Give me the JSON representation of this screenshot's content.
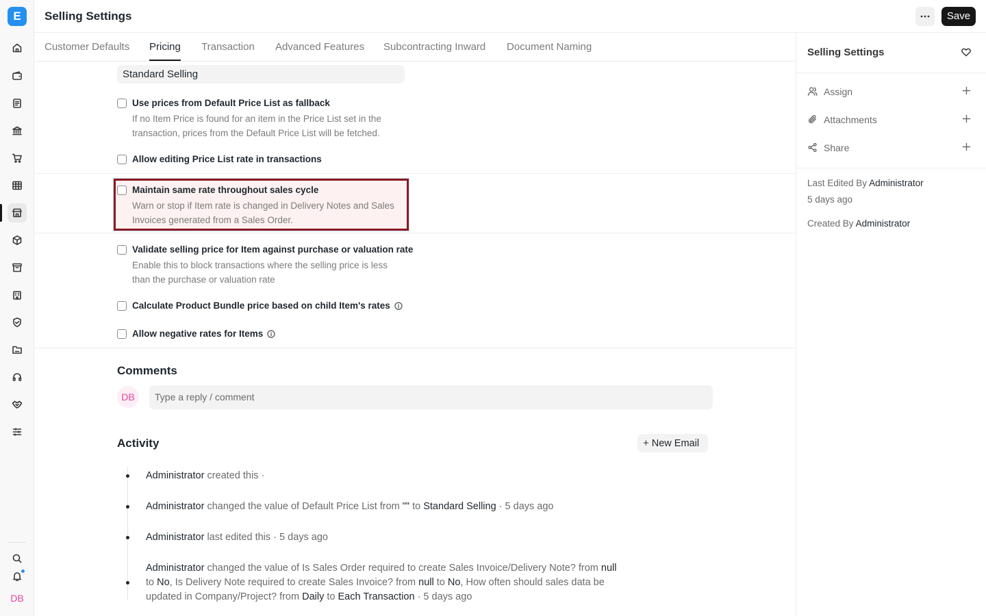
{
  "app": {
    "logo_letter": "E"
  },
  "header": {
    "title": "Selling Settings",
    "save_label": "Save"
  },
  "rail": {
    "icons": [
      "home-icon",
      "wallet-icon",
      "document-icon",
      "bank-icon",
      "cart-icon",
      "table-icon",
      "store-icon",
      "package-icon",
      "archive-icon",
      "building-icon",
      "shield-icon",
      "folder-icon",
      "headset-icon",
      "handshake-icon",
      "sliders-icon",
      "search-icon",
      "bell-icon"
    ],
    "active": "store-icon",
    "avatar": "DB"
  },
  "tabs": [
    {
      "label": "Customer Defaults",
      "active": false
    },
    {
      "label": "Pricing",
      "active": true
    },
    {
      "label": "Transaction",
      "active": false
    },
    {
      "label": "Advanced Features",
      "active": false
    },
    {
      "label": "Subcontracting Inward",
      "active": false
    },
    {
      "label": "Document Naming",
      "active": false
    }
  ],
  "form": {
    "default_price_list": "Standard Selling",
    "fields": [
      {
        "label": "Use prices from Default Price List as fallback",
        "checked": false,
        "description": "If no Item Price is found for an item in the Price List set in the transaction, prices from the Default Price List will be fetched."
      },
      {
        "label": "Allow editing Price List rate in transactions",
        "checked": false,
        "description": ""
      },
      {
        "label": "Maintain same rate throughout sales cycle",
        "checked": false,
        "description": "Warn or stop if Item rate is changed in Delivery Notes and Sales Invoices generated from a Sales Order."
      },
      {
        "label": "Validate selling price for Item against purchase or valuation rate",
        "checked": false,
        "description": "Enable this to block transactions where the selling price is less than the purchase or valuation rate"
      },
      {
        "label": "Calculate Product Bundle price based on child Item's rates",
        "checked": false,
        "description": ""
      },
      {
        "label": "Allow negative rates for Items",
        "checked": false,
        "description": ""
      }
    ]
  },
  "comments": {
    "heading": "Comments",
    "avatar": "DB",
    "placeholder": "Type a reply / comment"
  },
  "activity": {
    "heading": "Activity",
    "new_email_label": "New Email",
    "items": [
      {
        "user": "Administrator",
        "text": "created this ·"
      },
      {
        "user": "Administrator",
        "pre": "changed the value of Default Price List from",
        "from": "\"\"",
        "mid": "to",
        "to": "Standard Selling",
        "time": "· 5 days ago"
      },
      {
        "user": "Administrator",
        "text": "last edited this · 5 days ago"
      },
      {
        "user": "Administrator",
        "t1": "changed the value of Is Sales Order required to create Sales Invoice/Delivery Note? from",
        "v1": "null",
        "t2": "to",
        "v2": "No",
        "t3": ", Is Delivery Note required to create Sales Invoice? from",
        "v3": "null",
        "t4": "to",
        "v4": "No",
        "t5": ", How often should sales data be updated in Company/Project? from",
        "v5": "Daily",
        "t6": "to",
        "v6": "Each Transaction",
        "time": "· 5 days ago"
      }
    ]
  },
  "sidebar": {
    "title": "Selling Settings",
    "actions": [
      {
        "label": "Assign",
        "icon": "user-icon"
      },
      {
        "label": "Attachments",
        "icon": "paperclip-icon"
      },
      {
        "label": "Share",
        "icon": "share-icon"
      }
    ],
    "last_edited_label": "Last Edited By",
    "last_edited_user": "Administrator",
    "last_edited_time": "5 days ago",
    "created_label": "Created By",
    "created_user": "Administrator"
  },
  "colors": {
    "accent": "#2490ef",
    "primary_button": "#171717",
    "highlight_border": "#8b1a1f",
    "avatar_text": "#e5479c"
  }
}
